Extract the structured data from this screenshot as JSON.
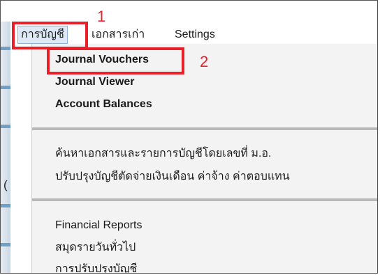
{
  "menubar": {
    "items": [
      {
        "label": "การบัญชี"
      },
      {
        "label": "เอกสารเก่า"
      },
      {
        "label": "Settings"
      }
    ]
  },
  "dropdown": {
    "group1": [
      {
        "label": "Journal Vouchers"
      },
      {
        "label": "Journal Viewer"
      },
      {
        "label": "Account Balances"
      }
    ],
    "group2": [
      {
        "label": "ค้นหาเอกสารและรายการบัญชีโดยเลขที่ ม.อ."
      },
      {
        "label": "ปรับปรุงบัญชีตัดจ่ายเงินเดือน ค่าจ้าง ค่าตอบแทน"
      }
    ],
    "group3": [
      {
        "label": "Financial Reports"
      },
      {
        "label": "สมุดรายวันทั่วไป"
      },
      {
        "label": "การปรับปรุงบัญชี"
      }
    ]
  },
  "annotations": {
    "callout1": "1",
    "callout2": "2",
    "color": "#e8202a"
  },
  "left_strip_glyph": "("
}
